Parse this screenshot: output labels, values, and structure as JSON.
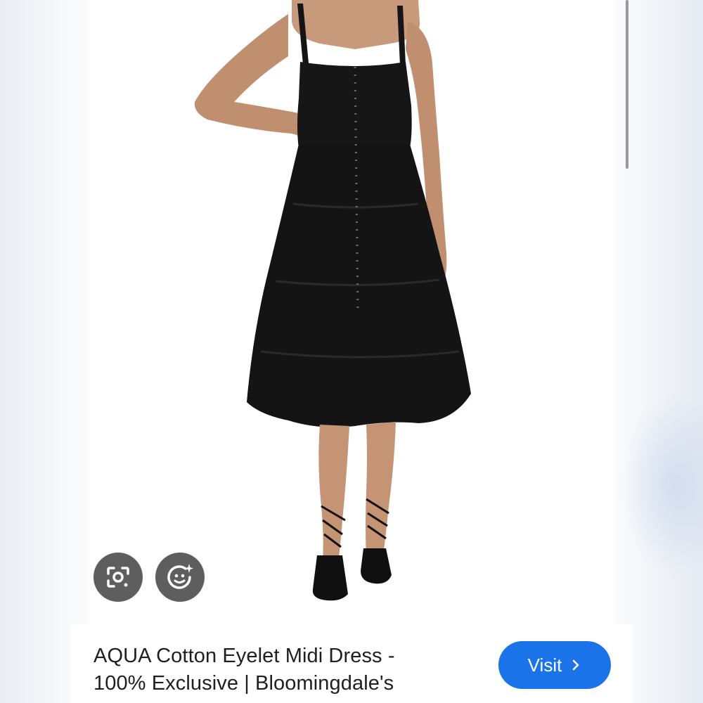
{
  "product": {
    "title_line1": "AQUA Cotton Eyelet Midi Dress -",
    "title_line2": "100% Exclusive | Bloomingdale's"
  },
  "actions": {
    "visit_label": "Visit"
  },
  "icons": {
    "lens": "google-lens-icon",
    "enhance": "image-enhance-icon",
    "visit": "chevron-right-icon"
  },
  "colors": {
    "visit_button": "#1a73e8",
    "overlay_button": "#5e5e5e",
    "dress": "#141414"
  }
}
